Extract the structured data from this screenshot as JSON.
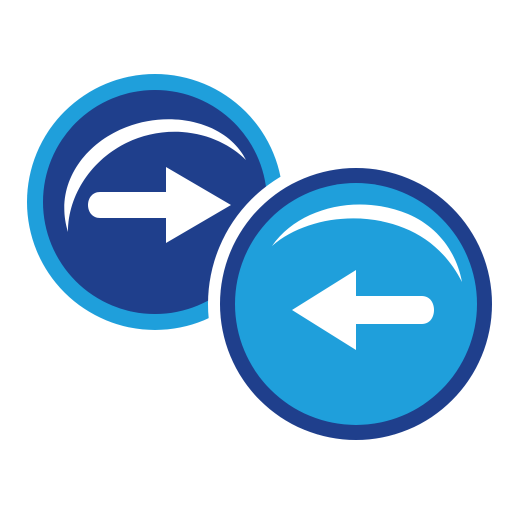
{
  "icon": {
    "name": "swap-arrows-icon",
    "colors": {
      "background": "#ffffff",
      "light_blue": "#1f9fdb",
      "dark_navy": "#1f3f8c",
      "white": "#ffffff"
    },
    "buttons": [
      {
        "name": "forward-arrow-button",
        "direction": "right",
        "arrow_icon": "arrow-right-icon"
      },
      {
        "name": "back-arrow-button",
        "direction": "left",
        "arrow_icon": "arrow-left-icon"
      }
    ]
  }
}
